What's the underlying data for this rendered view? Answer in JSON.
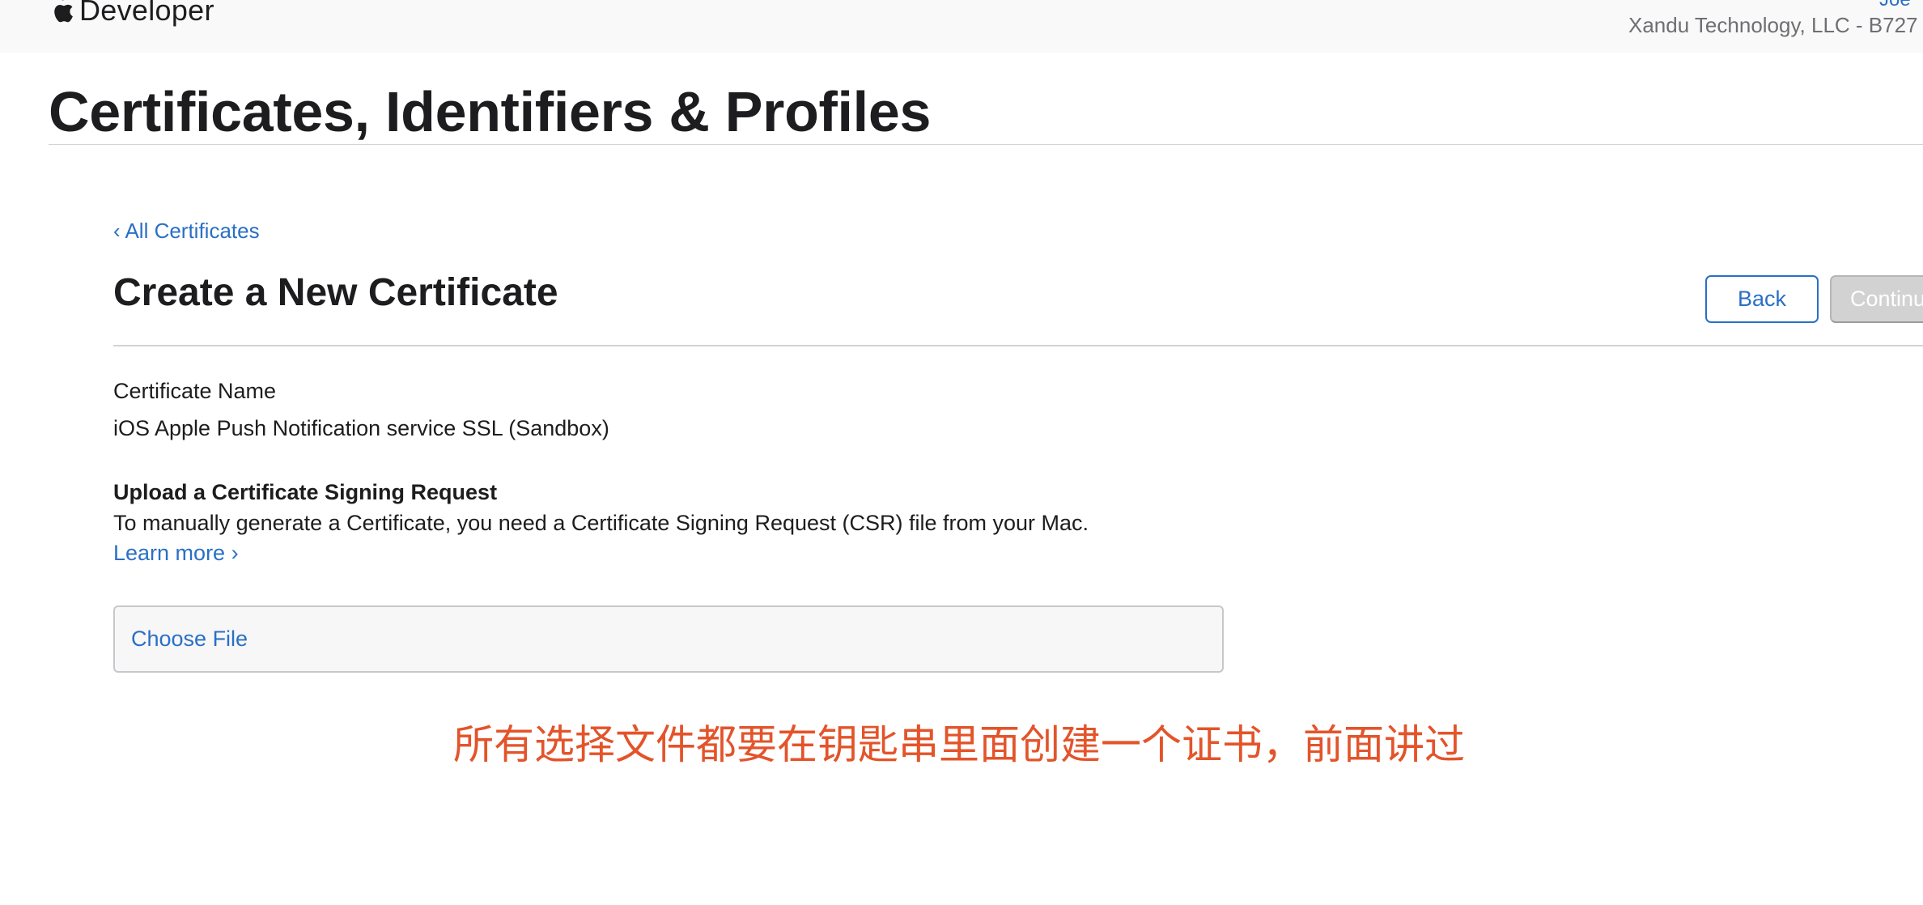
{
  "header": {
    "brand": "Developer",
    "account_top": "Joe",
    "account_name": "Xandu Technology, LLC - B727"
  },
  "page": {
    "title": "Certificates, Identifiers & Profiles"
  },
  "nav": {
    "back_link": "‹ All Certificates"
  },
  "section": {
    "title": "Create a New Certificate",
    "back_button": "Back",
    "continue_button": "Continue"
  },
  "certificate": {
    "name_label": "Certificate Name",
    "name_value": "iOS Apple Push Notification service SSL (Sandbox)"
  },
  "upload": {
    "title": "Upload a Certificate Signing Request",
    "description": "To manually generate a Certificate, you need a Certificate Signing Request (CSR) file from your Mac.",
    "learn_more": "Learn more ›",
    "choose_file": "Choose File"
  },
  "annotation": {
    "text": "所有选择文件都要在钥匙串里面创建一个证书，前面讲过"
  },
  "colors": {
    "link": "#2a6fc5",
    "annotation": "#e3542a",
    "disabled_button": "#d2d2d2"
  }
}
